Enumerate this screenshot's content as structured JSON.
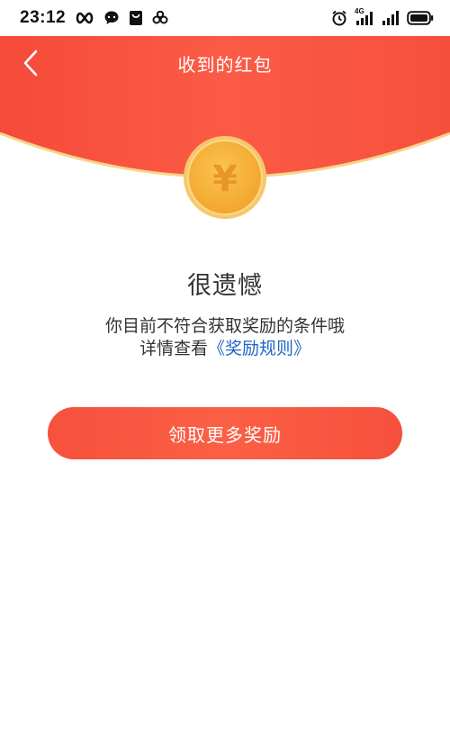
{
  "status_bar": {
    "time": "23:12",
    "network_label": "4G",
    "left_icons": [
      "infinity-icon",
      "chat-bubble-icon",
      "shopping-bag-icon",
      "clover-icon"
    ],
    "right_icons": [
      "alarm-icon",
      "signal-4g-icon",
      "signal-icon",
      "battery-icon"
    ]
  },
  "header": {
    "title": "收到的红包",
    "back_icon": "chevron-left-icon"
  },
  "coin": {
    "symbol": "¥"
  },
  "result": {
    "title": "很遗憾",
    "line1": "你目前不符合获取奖励的条件哦",
    "line2_prefix": "详情查看",
    "rules_link": "《奖励规则》"
  },
  "cta": {
    "label": "领取更多奖励"
  },
  "colors": {
    "header_red": "#f8503c",
    "header_border": "#f6d58a",
    "coin_gold": "#f5ad33",
    "link_blue": "#1f66c7",
    "button_red": "#f6513d"
  }
}
